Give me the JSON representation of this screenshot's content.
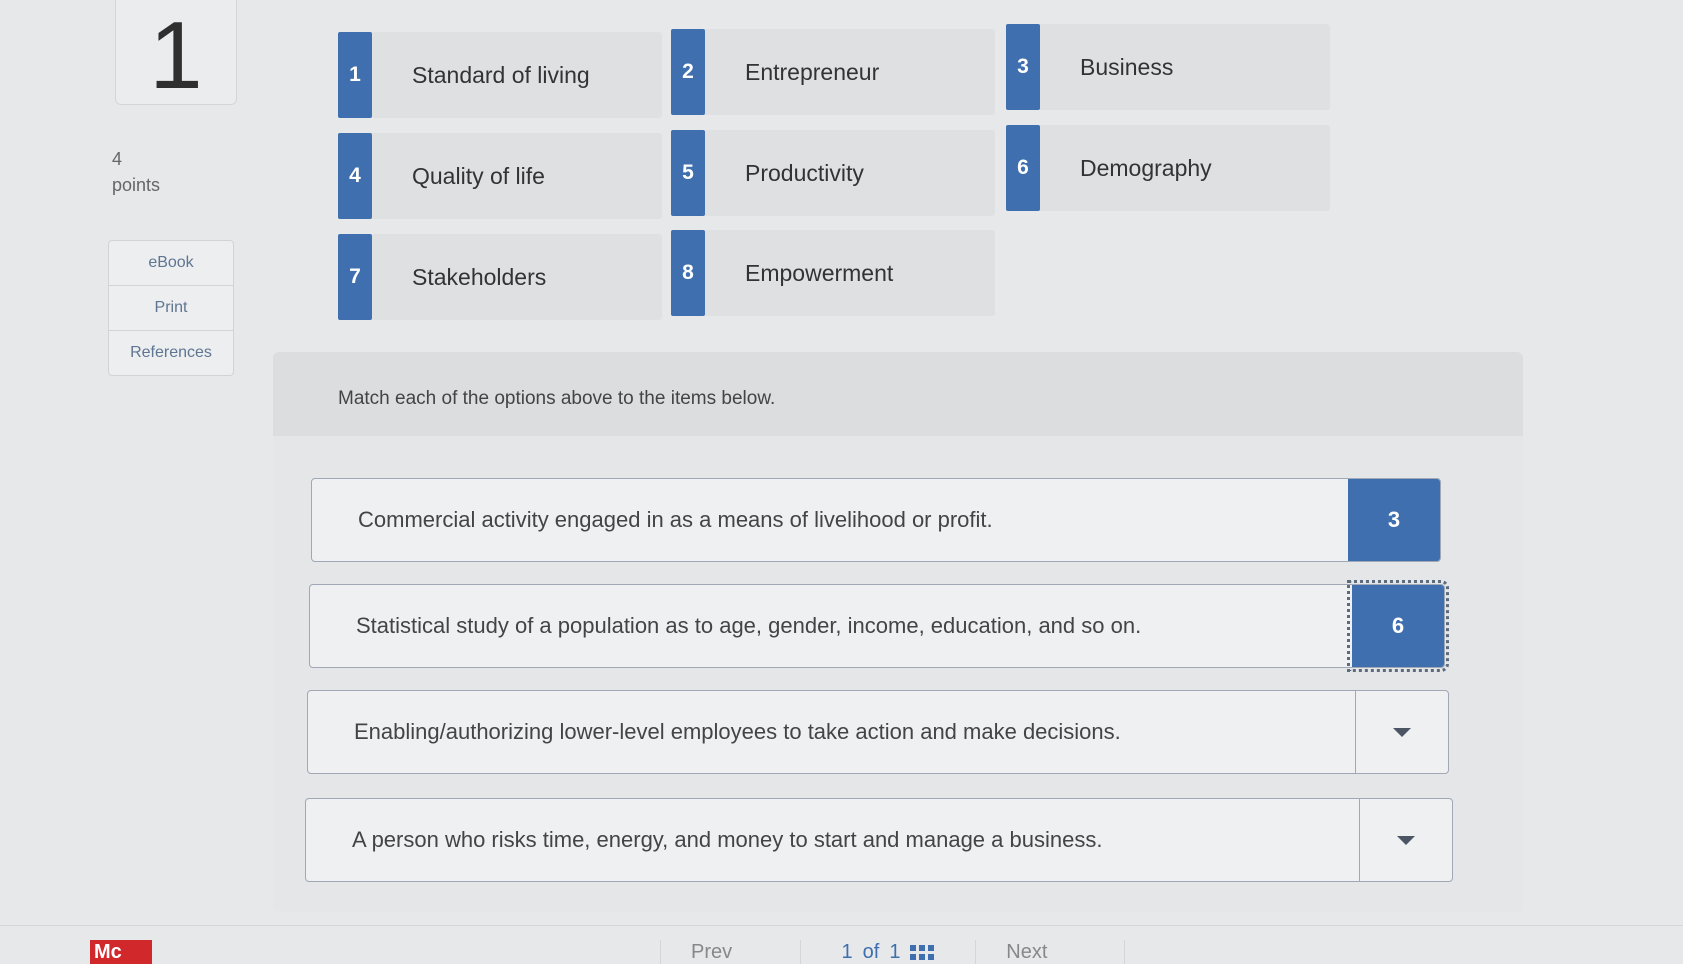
{
  "question": {
    "number": "1",
    "points_value": "4",
    "points_label": "points"
  },
  "tools": [
    "eBook",
    "Print",
    "References"
  ],
  "options": [
    {
      "num": "1",
      "label": "Standard of living"
    },
    {
      "num": "2",
      "label": "Entrepreneur"
    },
    {
      "num": "3",
      "label": "Business"
    },
    {
      "num": "4",
      "label": "Quality of life"
    },
    {
      "num": "5",
      "label": "Productivity"
    },
    {
      "num": "6",
      "label": "Demography"
    },
    {
      "num": "7",
      "label": "Stakeholders"
    },
    {
      "num": "8",
      "label": "Empowerment"
    }
  ],
  "instructions": "Match each of the options above to the items below.",
  "items": [
    {
      "text": "Commercial activity engaged in as a means of livelihood or profit.",
      "answer": "3"
    },
    {
      "text": "Statistical study of a population as to age, gender, income, education, and so on.",
      "answer": "6"
    },
    {
      "text": "Enabling/authorizing lower-level employees to take action and make decisions.",
      "answer": ""
    },
    {
      "text": "A person who risks time, energy, and money to start and manage a business.",
      "answer": ""
    }
  ],
  "footer": {
    "logo": "Mc",
    "prev": "Prev",
    "page_current": "1",
    "page_of": "of",
    "page_total": "1",
    "next": "Next"
  },
  "colors": {
    "accent": "#3f6fae",
    "logo": "#d0282b"
  }
}
